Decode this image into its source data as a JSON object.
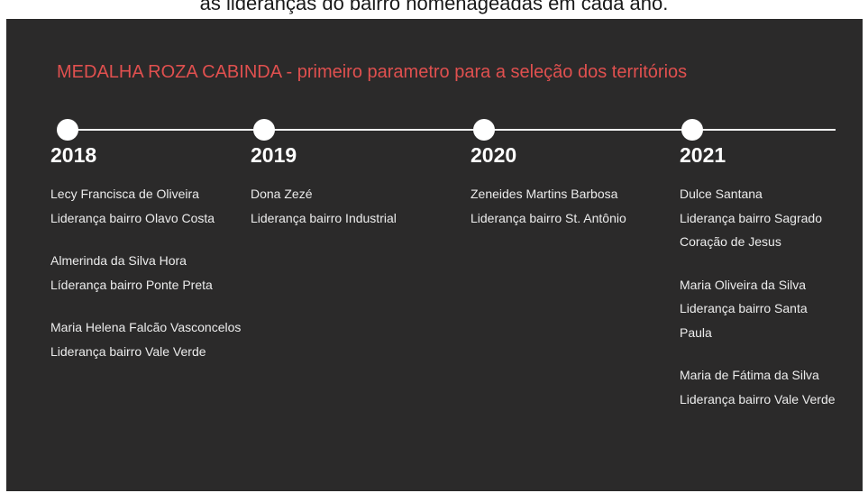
{
  "top_caption": "as lideranças do bairro homenageadas em cada ano.",
  "panel_title": "MEDALHA ROZA CABINDA - primeiro parametro para a seleção dos territórios",
  "colors": {
    "background": "#2b2a2a",
    "title": "#e0504f",
    "text": "#ececec"
  },
  "columns": [
    {
      "year": "2018",
      "entries": [
        {
          "lines": [
            "Lecy Francisca de Oliveira",
            "Liderança bairro Olavo Costa"
          ]
        },
        {
          "lines": [
            "Almerinda da Silva Hora",
            "Líderança bairro Ponte Preta"
          ]
        },
        {
          "lines": [
            "Maria Helena Falcão Vasconcelos",
            "Liderança bairro Vale Verde"
          ]
        }
      ]
    },
    {
      "year": "2019",
      "entries": [
        {
          "lines": [
            "Dona Zezé",
            "Liderança bairro Industrial"
          ]
        }
      ]
    },
    {
      "year": "2020",
      "entries": [
        {
          "lines": [
            "Zeneides Martins Barbosa",
            "Liderança bairro St. Antônio"
          ]
        }
      ]
    },
    {
      "year": "2021",
      "entries": [
        {
          "lines": [
            "Dulce Santana",
            "Liderança bairro Sagrado",
            "Coração de Jesus"
          ]
        },
        {
          "lines": [
            "Maria Oliveira da Silva",
            "Liderança bairro Santa",
            "Paula"
          ]
        },
        {
          "lines": [
            "Maria de Fátima da Silva",
            "Liderança bairro Vale Verde"
          ]
        }
      ]
    }
  ]
}
